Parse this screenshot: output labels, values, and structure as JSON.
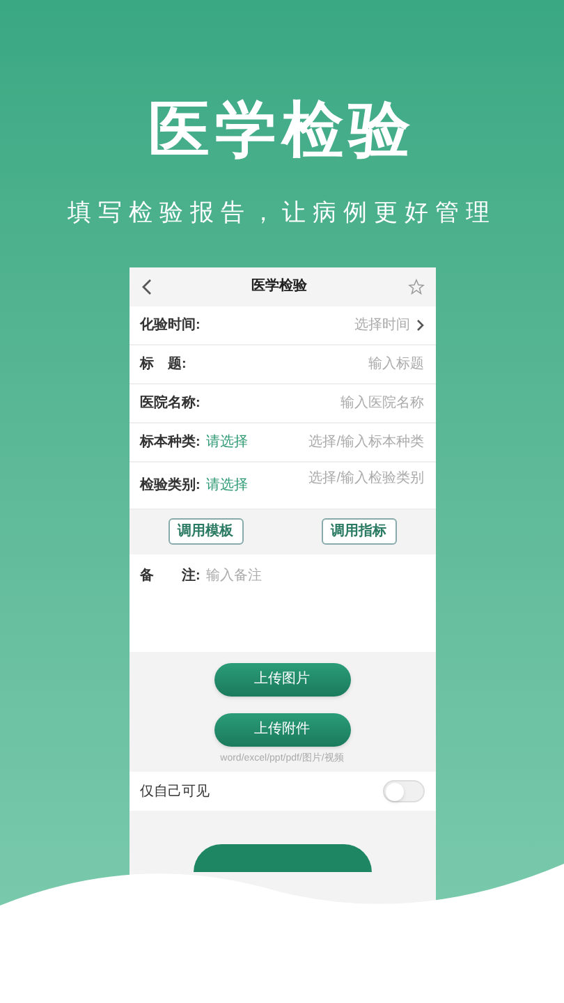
{
  "headline": "医学检验",
  "tagline": "填写检验报告，让病例更好管理",
  "screen": {
    "title": "医学检验",
    "fields": [
      {
        "kind": "picker",
        "label": "化验时间:",
        "placeholder": "选择时间"
      },
      {
        "kind": "input",
        "label": "标　题:",
        "placeholder": "输入标题"
      },
      {
        "kind": "input",
        "label": "医院名称:",
        "placeholder": "输入医院名称"
      },
      {
        "kind": "input",
        "label": "标本种类:",
        "choice": "请选择",
        "placeholder": "选择/输入标本种类"
      },
      {
        "kind": "input",
        "label": "检验类别:",
        "choice": "请选择",
        "placeholder": "选择/输入检验类别"
      }
    ],
    "tool_buttons": [
      "调用模板",
      "调用指标"
    ],
    "remark": {
      "label": "备　　注:",
      "placeholder": "输入备注"
    },
    "upload_buttons": [
      "上传图片",
      "上传附件"
    ],
    "upload_hint": "word/excel/ppt/pdf/图片/视频",
    "private": {
      "label": "仅自己可见",
      "on": false
    }
  }
}
